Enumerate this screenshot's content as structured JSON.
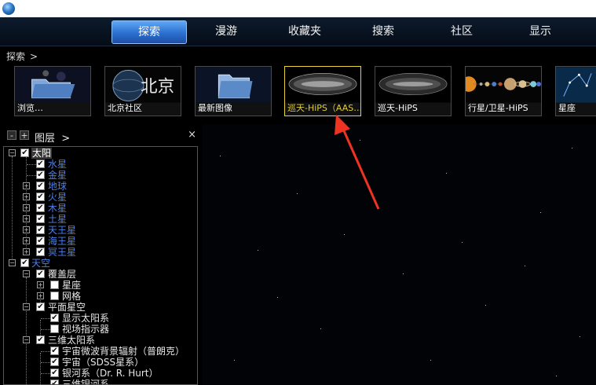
{
  "menu": {
    "tabs": [
      {
        "label": "探索",
        "active": true
      },
      {
        "label": "漫游",
        "active": false
      },
      {
        "label": "收藏夹",
        "active": false
      },
      {
        "label": "搜索",
        "active": false
      },
      {
        "label": "社区",
        "active": false
      },
      {
        "label": "显示",
        "active": false
      }
    ]
  },
  "breadcrumb": {
    "text": "探索",
    "arrow": ">"
  },
  "thumbnails": [
    {
      "label": "浏览…",
      "icon": "folder-icon"
    },
    {
      "label": "北京社区",
      "icon": "globe-icon"
    },
    {
      "label": "最新图像",
      "icon": "folder-icon"
    },
    {
      "label": "巡天-HiPS（AAS…",
      "icon": "sky-survey-icon",
      "selected": true
    },
    {
      "label": "巡天-HiPS",
      "icon": "sky-survey-icon"
    },
    {
      "label": "行星/卫星-HiPS",
      "icon": "planets-icon"
    },
    {
      "label": "星座",
      "icon": "constellation-icon"
    }
  ],
  "layers_panel": {
    "title": "图层",
    "title_arrow": ">",
    "minus": "-",
    "plus": "+",
    "close": "×"
  },
  "tree": {
    "sun": "太阳",
    "planets": [
      "水星",
      "金星",
      "地球",
      "火星",
      "木星",
      "土星",
      "天王星",
      "海王星",
      "冥王星"
    ],
    "sky": "天空",
    "overlays": "覆盖层",
    "constellations": "星座",
    "grids": "网格",
    "flat_sky": "平面星空",
    "show_solar_system": "显示太阳系",
    "fov_indicator": "视场指示器",
    "solar_3d": "三维太阳系",
    "cmb": "宇宙微波背景辐射（普朗克）",
    "sdss": "宇宙（SDSS星系）",
    "milky_way": "银河系（Dr. R. Hurt）",
    "milky_way_3d": "三维银河系"
  },
  "colors": {
    "accent_tab": "#2b6fd0",
    "selected_border": "#e6d23a",
    "tree_blue": "#4b7fe6",
    "arrow_red": "#ee3322"
  }
}
